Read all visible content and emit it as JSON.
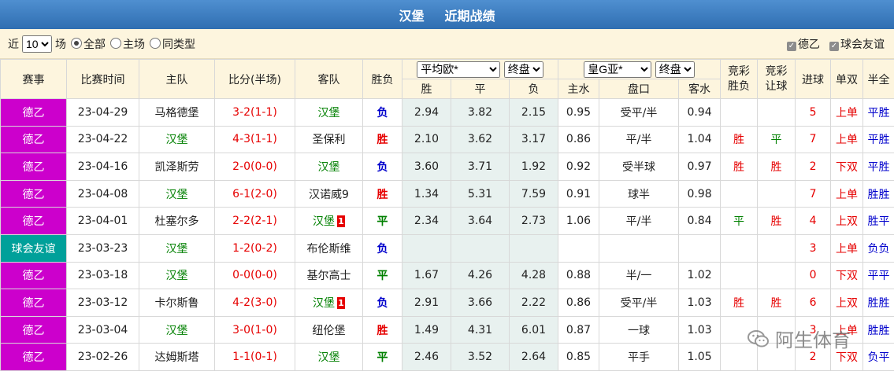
{
  "header": {
    "team": "汉堡",
    "subtitle": "近期战绩"
  },
  "toolbar": {
    "prefix": "近",
    "count": "10",
    "suffix": "场",
    "filters": [
      {
        "label": "全部",
        "selected": true
      },
      {
        "label": "主场",
        "selected": false
      },
      {
        "label": "同类型",
        "selected": false
      }
    ],
    "checks": [
      {
        "label": "德乙",
        "checked": true
      },
      {
        "label": "球会友谊",
        "checked": true
      }
    ]
  },
  "columns": {
    "league": "赛事",
    "date": "比赛时间",
    "home": "主队",
    "score": "比分(半场)",
    "away": "客队",
    "result": "胜负",
    "euro_select": "平均欧*",
    "euro_phase": "终盘",
    "asia_select": "皇G亚*",
    "asia_phase": "终盘",
    "euro_sub": [
      "胜",
      "平",
      "负"
    ],
    "asia_sub": [
      "主水",
      "盘口",
      "客水"
    ],
    "jc_result": "竞彩\n胜负",
    "jc_handicap": "竞彩\n让球",
    "goals": "进球",
    "oddeven": "单双",
    "half_full": "半全"
  },
  "colors": {
    "league_dezi": "#cc00cc",
    "league_friendly": "#00a09a"
  },
  "rows": [
    {
      "league": "德乙",
      "lc": "dezi",
      "date": "23-04-29",
      "home": "马格德堡",
      "home_is_team": false,
      "score": "3-2(1-1)",
      "away": "汉堡",
      "away_is_team": true,
      "away_card": "",
      "result": "负",
      "r": "lose",
      "w": "2.94",
      "d": "3.82",
      "l": "2.15",
      "hw": "0.95",
      "hc": "受平/半",
      "aw": "0.94",
      "jc1": "",
      "jc1c": "",
      "jc2": "",
      "jc2c": "",
      "goals": "5",
      "oe": "上单",
      "hf": "平胜"
    },
    {
      "league": "德乙",
      "lc": "dezi",
      "date": "23-04-22",
      "home": "汉堡",
      "home_is_team": true,
      "score": "4-3(1-1)",
      "away": "圣保利",
      "away_is_team": false,
      "away_card": "",
      "result": "胜",
      "r": "win",
      "w": "2.10",
      "d": "3.62",
      "l": "3.17",
      "hw": "0.86",
      "hc": "平/半",
      "aw": "1.04",
      "jc1": "胜",
      "jc1c": "red",
      "jc2": "平",
      "jc2c": "green",
      "goals": "7",
      "oe": "上单",
      "hf": "平胜"
    },
    {
      "league": "德乙",
      "lc": "dezi",
      "date": "23-04-16",
      "home": "凯泽斯劳",
      "home_is_team": false,
      "score": "2-0(0-0)",
      "away": "汉堡",
      "away_is_team": true,
      "away_card": "",
      "result": "负",
      "r": "lose",
      "w": "3.60",
      "d": "3.71",
      "l": "1.92",
      "hw": "0.92",
      "hc": "受半球",
      "aw": "0.97",
      "jc1": "胜",
      "jc1c": "red",
      "jc2": "胜",
      "jc2c": "red",
      "goals": "2",
      "oe": "下双",
      "hf": "平胜"
    },
    {
      "league": "德乙",
      "lc": "dezi",
      "date": "23-04-08",
      "home": "汉堡",
      "home_is_team": true,
      "score": "6-1(2-0)",
      "away": "汉诺威9",
      "away_is_team": false,
      "away_card": "",
      "result": "胜",
      "r": "win",
      "w": "1.34",
      "d": "5.31",
      "l": "7.59",
      "hw": "0.91",
      "hc": "球半",
      "aw": "0.98",
      "jc1": "",
      "jc1c": "",
      "jc2": "",
      "jc2c": "",
      "goals": "7",
      "oe": "上单",
      "hf": "胜胜"
    },
    {
      "league": "德乙",
      "lc": "dezi",
      "date": "23-04-01",
      "home": "杜塞尔多",
      "home_is_team": false,
      "score": "2-2(2-1)",
      "away": "汉堡",
      "away_is_team": true,
      "away_card": "1",
      "result": "平",
      "r": "draw",
      "w": "2.34",
      "d": "3.64",
      "l": "2.73",
      "hw": "1.06",
      "hc": "平/半",
      "aw": "0.84",
      "jc1": "平",
      "jc1c": "green",
      "jc2": "胜",
      "jc2c": "red",
      "goals": "4",
      "oe": "上双",
      "hf": "胜平"
    },
    {
      "league": "球会友谊",
      "lc": "friendly",
      "date": "23-03-23",
      "home": "汉堡",
      "home_is_team": true,
      "score": "1-2(0-2)",
      "away": "布伦斯维",
      "away_is_team": false,
      "away_card": "",
      "result": "负",
      "r": "lose",
      "w": "",
      "d": "",
      "l": "",
      "hw": "",
      "hc": "",
      "aw": "",
      "jc1": "",
      "jc1c": "",
      "jc2": "",
      "jc2c": "",
      "goals": "3",
      "oe": "上单",
      "hf": "负负"
    },
    {
      "league": "德乙",
      "lc": "dezi",
      "date": "23-03-18",
      "home": "汉堡",
      "home_is_team": true,
      "score": "0-0(0-0)",
      "away": "基尔高士",
      "away_is_team": false,
      "away_card": "",
      "result": "平",
      "r": "draw",
      "w": "1.67",
      "d": "4.26",
      "l": "4.28",
      "hw": "0.88",
      "hc": "半/一",
      "aw": "1.02",
      "jc1": "",
      "jc1c": "",
      "jc2": "",
      "jc2c": "",
      "goals": "0",
      "oe": "下双",
      "hf": "平平"
    },
    {
      "league": "德乙",
      "lc": "dezi",
      "date": "23-03-12",
      "home": "卡尔斯鲁",
      "home_is_team": false,
      "score": "4-2(3-0)",
      "away": "汉堡",
      "away_is_team": true,
      "away_card": "1",
      "result": "负",
      "r": "lose",
      "w": "2.91",
      "d": "3.66",
      "l": "2.22",
      "hw": "0.86",
      "hc": "受平/半",
      "aw": "1.03",
      "jc1": "胜",
      "jc1c": "red",
      "jc2": "胜",
      "jc2c": "red",
      "goals": "6",
      "oe": "上双",
      "hf": "胜胜"
    },
    {
      "league": "德乙",
      "lc": "dezi",
      "date": "23-03-04",
      "home": "汉堡",
      "home_is_team": true,
      "score": "3-0(1-0)",
      "away": "纽伦堡",
      "away_is_team": false,
      "away_card": "",
      "result": "胜",
      "r": "win",
      "w": "1.49",
      "d": "4.31",
      "l": "6.01",
      "hw": "0.87",
      "hc": "一球",
      "aw": "1.03",
      "jc1": "",
      "jc1c": "",
      "jc2": "",
      "jc2c": "",
      "goals": "3",
      "oe": "上单",
      "hf": "胜胜"
    },
    {
      "league": "德乙",
      "lc": "dezi",
      "date": "23-02-26",
      "home": "达姆斯塔",
      "home_is_team": false,
      "score": "1-1(0-1)",
      "away": "汉堡",
      "away_is_team": true,
      "away_card": "",
      "result": "平",
      "r": "draw",
      "w": "2.46",
      "d": "3.52",
      "l": "2.64",
      "hw": "0.85",
      "hc": "平手",
      "aw": "1.05",
      "jc1": "",
      "jc1c": "",
      "jc2": "",
      "jc2c": "",
      "goals": "2",
      "oe": "下双",
      "hf": "负平"
    }
  ],
  "watermark": "阿生体育"
}
